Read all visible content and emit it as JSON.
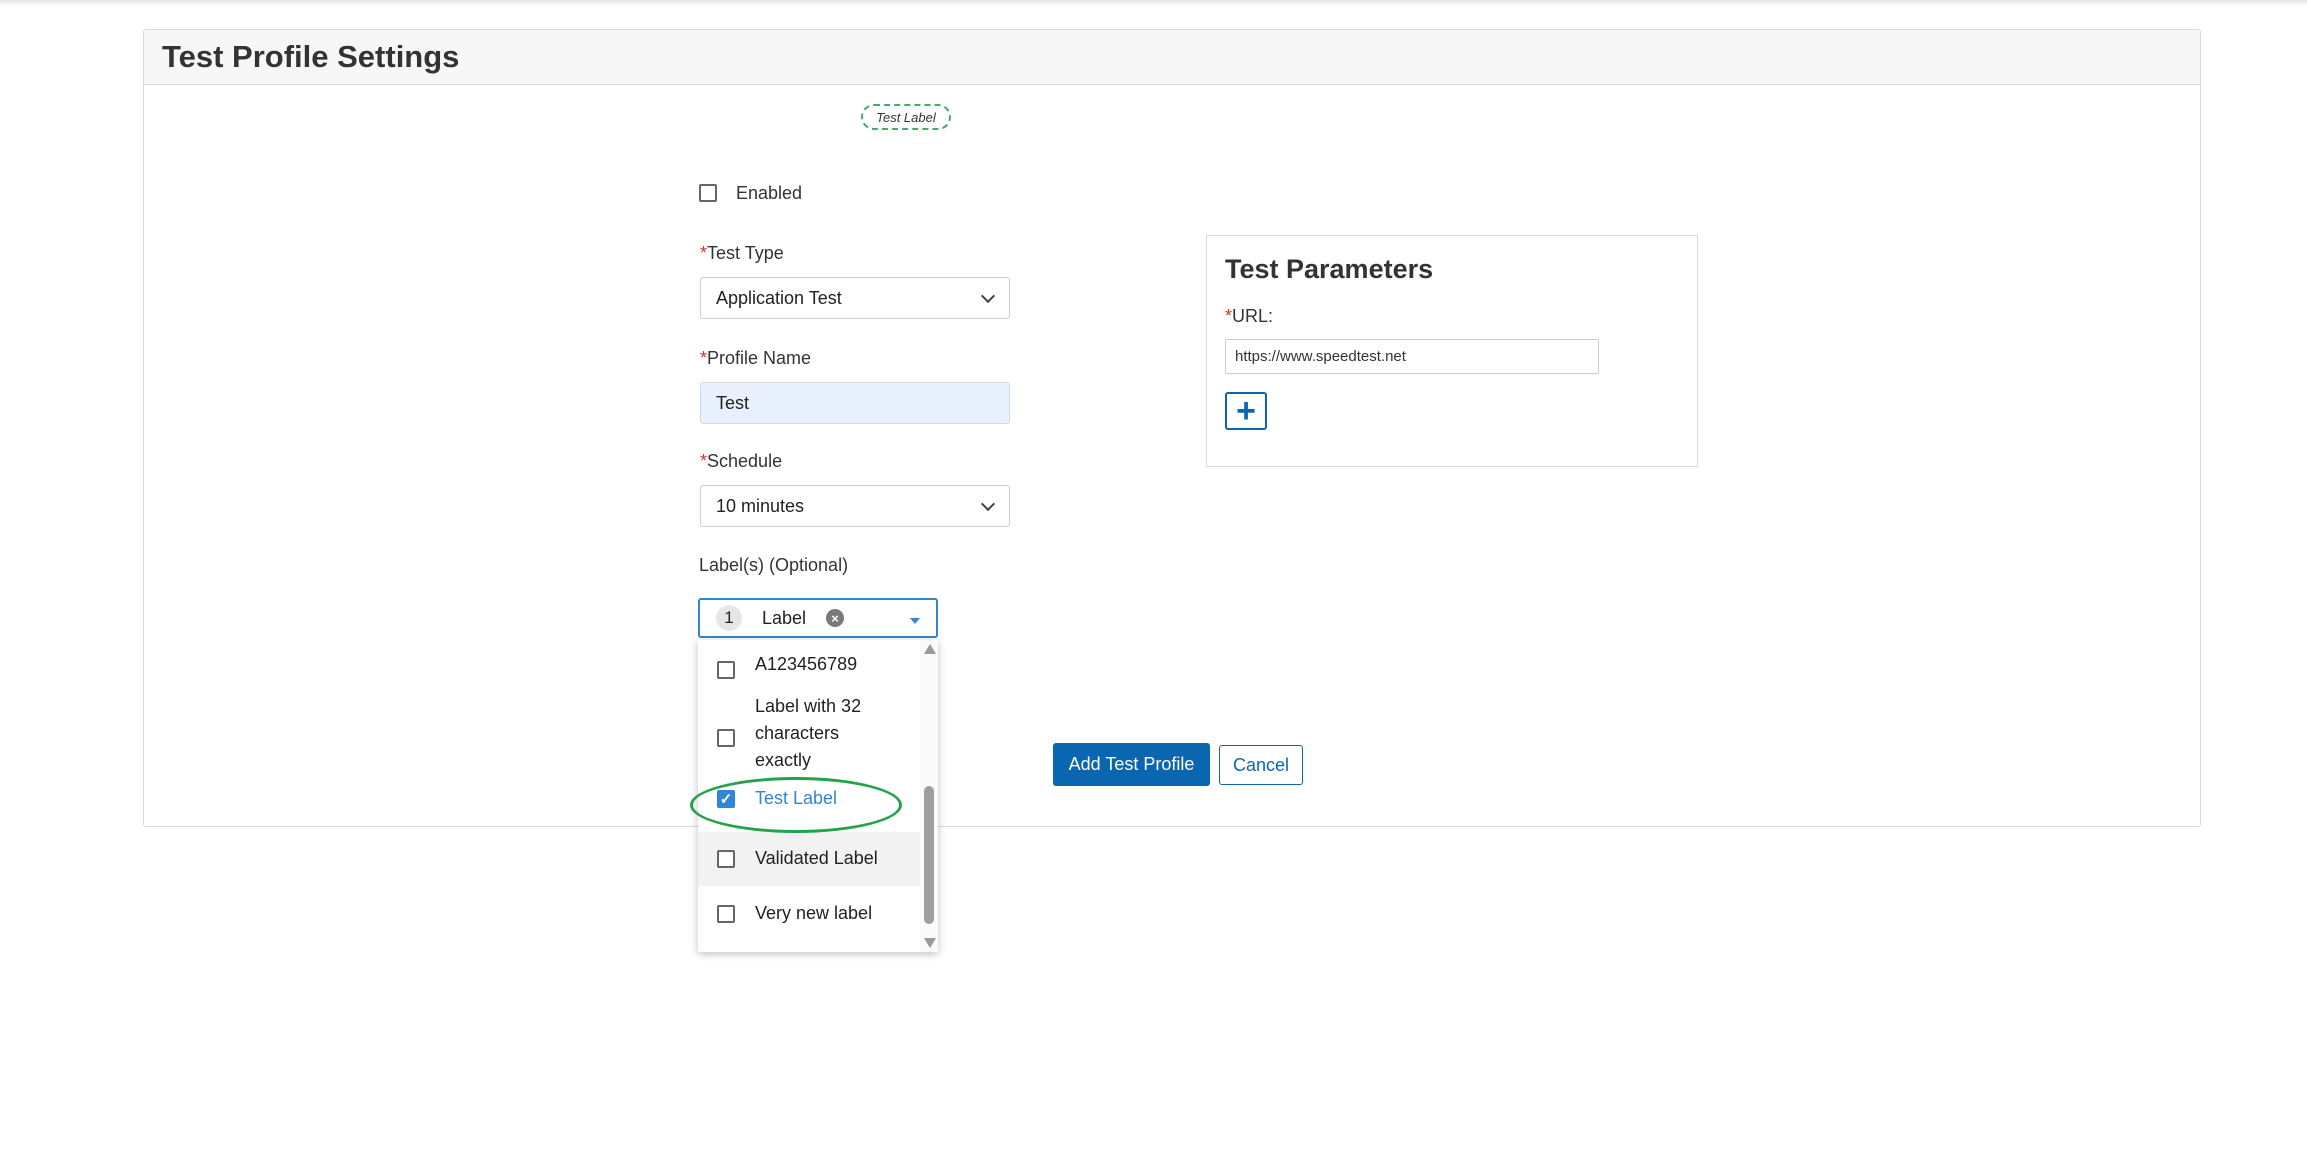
{
  "page": {
    "title": "Test Profile Settings"
  },
  "floating_tag": "Test Label",
  "form": {
    "enabled_label": "Enabled",
    "enabled_checked": false,
    "required_mark": "*",
    "test_type": {
      "label": "Test Type",
      "value": "Application Test"
    },
    "profile_name": {
      "label": "Profile Name",
      "value": "Test"
    },
    "schedule": {
      "label": "Schedule",
      "value": "10 minutes"
    },
    "labels": {
      "label": "Label(s) (Optional)",
      "selected_count": "1",
      "selected_text": "Label",
      "clear_icon": "×",
      "options": [
        {
          "text": "A123456789",
          "checked": false
        },
        {
          "text": "Label with 32 characters exactly",
          "checked": false
        },
        {
          "text": "Test Label",
          "checked": true
        },
        {
          "text": "Validated Label",
          "checked": false
        },
        {
          "text": "Very new label",
          "checked": false
        }
      ]
    }
  },
  "actions": {
    "add_label": "Add Test Profile",
    "cancel_label": "Cancel"
  },
  "test_parameters": {
    "title": "Test Parameters",
    "url_label": "URL:",
    "url_value": "https://www.speedtest.net",
    "add_icon": "+"
  },
  "colors": {
    "accent": "#2f86d6",
    "primary_button": "#0b66b1",
    "required": "#d32f2f",
    "highlight_ellipse": "#22a447"
  }
}
